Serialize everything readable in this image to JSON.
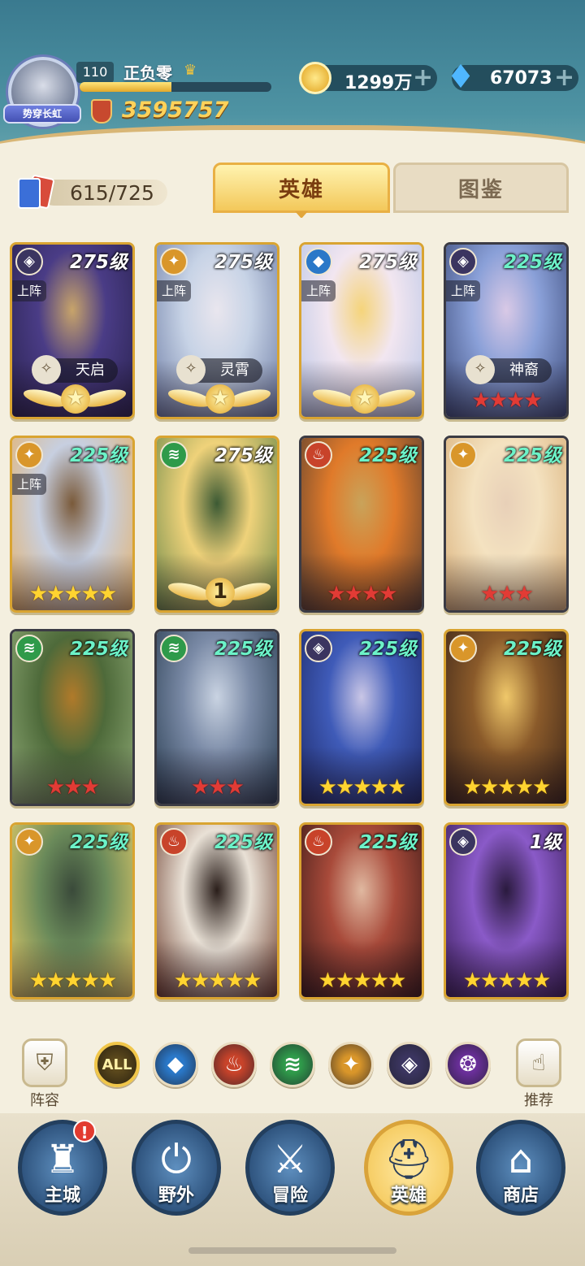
{
  "player": {
    "level": "110",
    "name": "正负零",
    "title_banner": "势穿长虹",
    "power": "3595757",
    "xp_fraction": 0.48
  },
  "resources": {
    "gold": "1299万",
    "gems": "67073"
  },
  "collection": {
    "count": "615/725"
  },
  "tabs": {
    "heroes": "英雄",
    "codex": "图鉴"
  },
  "heroes": [
    {
      "level": "275级",
      "element": "dark",
      "on_team": "上阵",
      "faction": "天启",
      "stars": "★",
      "star_type": "gold-wing",
      "art": [
        "#2a2350",
        "#4a3c86",
        "#c8a46a"
      ]
    },
    {
      "level": "275级",
      "element": "light",
      "on_team": "上阵",
      "faction": "灵霄",
      "stars": "★",
      "star_type": "gold-wing",
      "art": [
        "#6f7ea6",
        "#c7d3e6",
        "#e9e6ee"
      ]
    },
    {
      "level": "275级",
      "element": "water",
      "on_team": "上阵",
      "faction": "",
      "stars": "★",
      "star_type": "gold-wing",
      "art": [
        "#b9c6e6",
        "#f2e6f0",
        "#f5d47a"
      ]
    },
    {
      "level": "225级",
      "element": "dark",
      "on_team": "上阵",
      "faction": "神裔",
      "stars": "★★★★",
      "star_type": "red",
      "art": [
        "#3c4b7a",
        "#8aa0d8",
        "#d9c9e6"
      ]
    },
    {
      "level": "225级",
      "element": "light",
      "on_team": "上阵",
      "faction": "",
      "stars": "★★★★★",
      "star_type": "gold",
      "art": [
        "#e6b26a",
        "#c7cfe0",
        "#7a5a3a"
      ]
    },
    {
      "level": "275级",
      "element": "wind",
      "on_team": "",
      "faction": "",
      "stars": "1",
      "star_type": "gold-wing-num",
      "art": [
        "#6d8a4a",
        "#efd27a",
        "#3c5a34"
      ]
    },
    {
      "level": "225级",
      "element": "fire",
      "on_team": "",
      "faction": "",
      "stars": "★★★★",
      "star_type": "red",
      "art": [
        "#5a4030",
        "#e07a2a",
        "#c9a35a"
      ]
    },
    {
      "level": "225级",
      "element": "light",
      "on_team": "",
      "faction": "",
      "stars": "★★★",
      "star_type": "red",
      "art": [
        "#d9b07a",
        "#f4e2c0",
        "#e8d0b8"
      ]
    },
    {
      "level": "225级",
      "element": "wind",
      "on_team": "",
      "faction": "",
      "stars": "★★★",
      "star_type": "red",
      "art": [
        "#8faa76",
        "#4e6a3a",
        "#b07a2a"
      ]
    },
    {
      "level": "225级",
      "element": "wind",
      "on_team": "",
      "faction": "",
      "stars": "★★★",
      "star_type": "red",
      "art": [
        "#2a3e52",
        "#7a8aa6",
        "#c9d3e2"
      ]
    },
    {
      "level": "225级",
      "element": "dark",
      "on_team": "",
      "faction": "",
      "stars": "★★★★★",
      "star_type": "gold",
      "art": [
        "#1e2a6a",
        "#3f5bb8",
        "#c9c6e6"
      ]
    },
    {
      "level": "225级",
      "element": "light",
      "on_team": "",
      "faction": "",
      "stars": "★★★★★",
      "star_type": "gold",
      "art": [
        "#3a2418",
        "#8a5a2a",
        "#f0c86a"
      ]
    },
    {
      "level": "225级",
      "element": "light",
      "on_team": "",
      "faction": "",
      "stars": "★★★★★",
      "star_type": "gold",
      "art": [
        "#e9cf6a",
        "#6a8a5a",
        "#3a4a3a"
      ]
    },
    {
      "level": "225级",
      "element": "fire",
      "on_team": "",
      "faction": "",
      "stars": "★★★★★",
      "star_type": "gold",
      "art": [
        "#6a3a2a",
        "#e9e1d6",
        "#2a1e1a"
      ]
    },
    {
      "level": "225级",
      "element": "fire",
      "on_team": "",
      "faction": "",
      "stars": "★★★★★",
      "star_type": "gold",
      "art": [
        "#3a1a18",
        "#a84a3a",
        "#e0b8a0"
      ]
    },
    {
      "level": "1级",
      "element": "dark",
      "on_team": "",
      "faction": "",
      "stars": "★★★★★",
      "star_type": "gold",
      "art": [
        "#3a1e5a",
        "#8a5ac8",
        "#2a1a3e"
      ]
    }
  ],
  "elements": {
    "dark": {
      "color": "#3b3560",
      "glyph": "◈"
    },
    "light": {
      "color": "#d9962a",
      "glyph": "✦"
    },
    "water": {
      "color": "#2a78c8",
      "glyph": "◆"
    },
    "wind": {
      "color": "#2f9a4a",
      "glyph": "≋"
    },
    "fire": {
      "color": "#c8432a",
      "glyph": "♨"
    }
  },
  "filters": {
    "lineup_label": "阵容",
    "all_label": "ALL",
    "recommend_label": "推荐",
    "items": [
      {
        "name": "water",
        "glyph": "◆",
        "color": "#2a78c8"
      },
      {
        "name": "fire",
        "glyph": "♨",
        "color": "#c8432a"
      },
      {
        "name": "wind",
        "glyph": "≋",
        "color": "#2f9a4a"
      },
      {
        "name": "light",
        "glyph": "✦",
        "color": "#d9962a"
      },
      {
        "name": "dark",
        "glyph": "◈",
        "color": "#3b3560"
      },
      {
        "name": "arcane",
        "glyph": "❂",
        "color": "#6a2f9a"
      }
    ]
  },
  "nav": [
    {
      "label": "主城",
      "glyph": "♜",
      "alert": "!"
    },
    {
      "label": "野外",
      "glyph": "⏻"
    },
    {
      "label": "冒险",
      "glyph": "⚔"
    },
    {
      "label": "英雄",
      "glyph": "⛑"
    },
    {
      "label": "商店",
      "glyph": "⌂"
    }
  ]
}
